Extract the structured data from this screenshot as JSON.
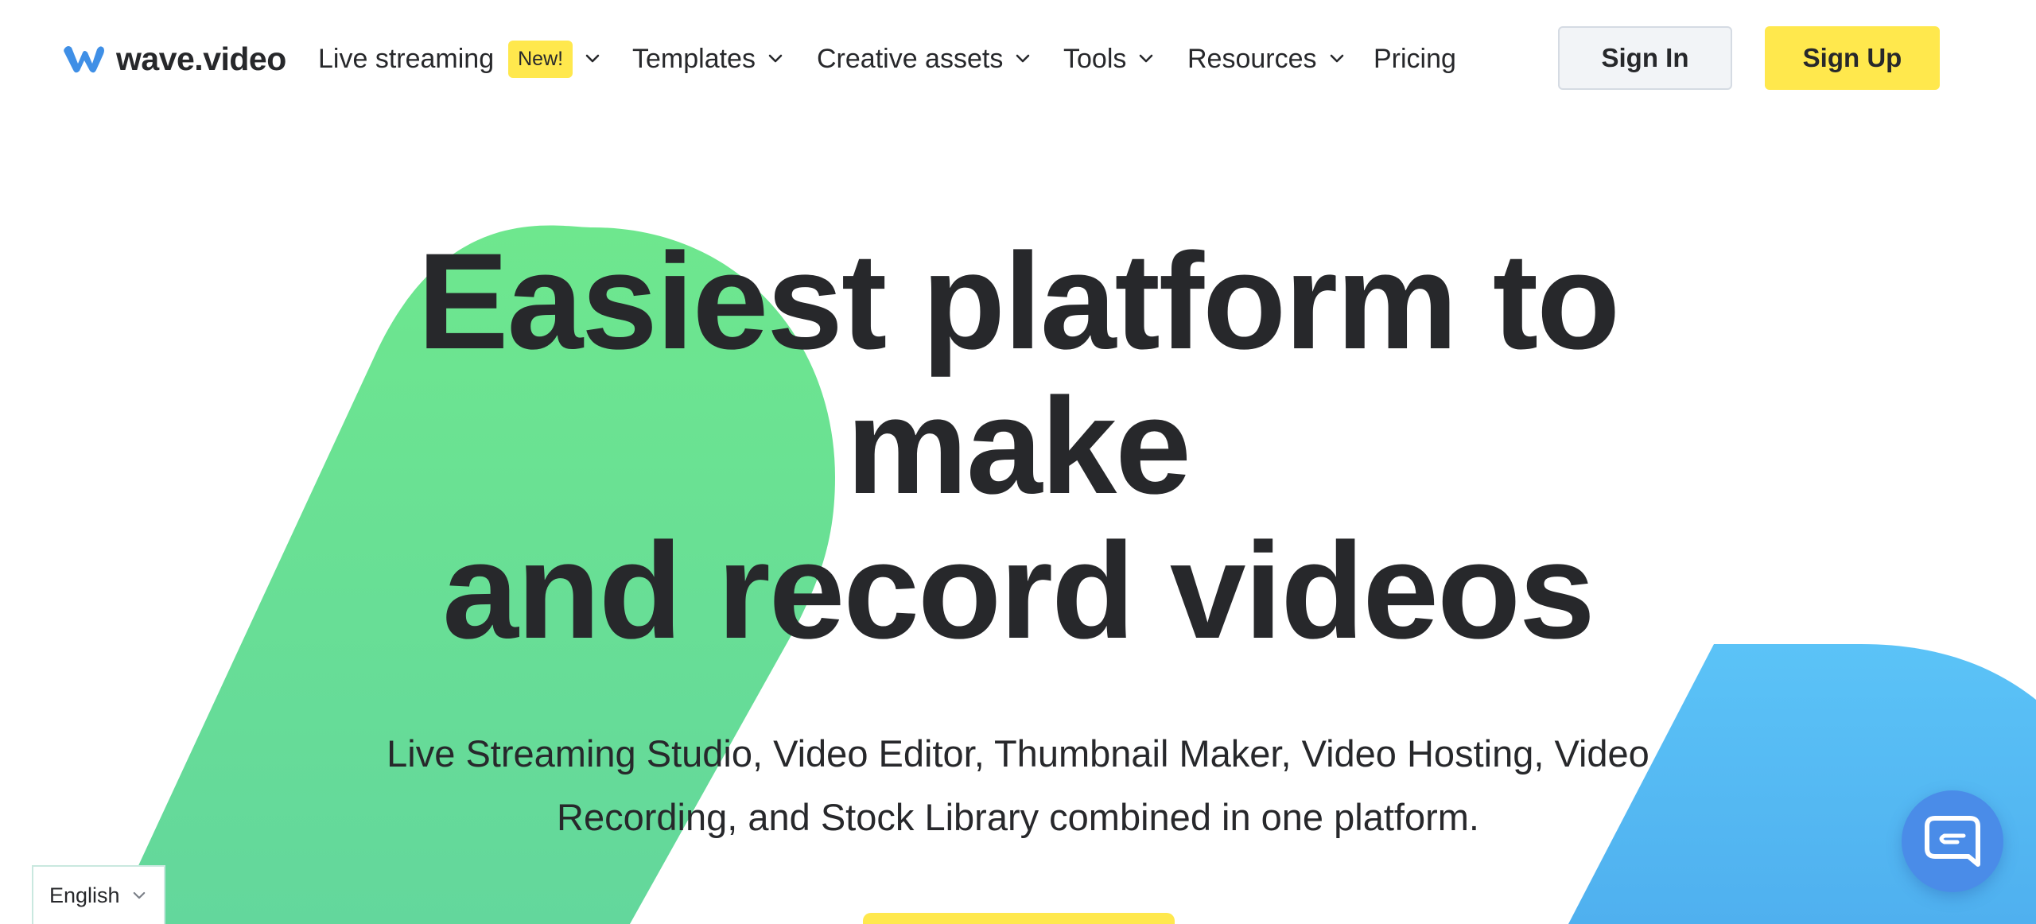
{
  "brand": {
    "name": "wave.video",
    "colors": {
      "text": "#27282b",
      "yellow": "#ffe84d",
      "green": "#6ee78e",
      "blue": "#5bc0f6",
      "logo_blue": "#3f8fe6",
      "chat_blue": "#4a8ce8"
    }
  },
  "nav": {
    "items": [
      {
        "label": "Live streaming",
        "badge": "New!",
        "has_dropdown": true
      },
      {
        "label": "Templates",
        "has_dropdown": true
      },
      {
        "label": "Creative assets",
        "has_dropdown": true
      },
      {
        "label": "Tools",
        "has_dropdown": true
      },
      {
        "label": "Resources",
        "has_dropdown": true
      },
      {
        "label": "Pricing",
        "has_dropdown": false
      }
    ],
    "sign_in_label": "Sign In",
    "sign_up_label": "Sign Up"
  },
  "hero": {
    "title_lines": [
      "Easiest platform to",
      "make",
      "and record videos"
    ],
    "subtitle_lines": [
      "Live Streaming Studio, Video Editor, Thumbnail Maker, Video Hosting, Video",
      "Recording, and Stock Library combined in one platform."
    ]
  },
  "language_selector": {
    "value": "English",
    "icon": "chevron-down-icon"
  },
  "chat": {
    "icon": "chat-bubble-icon"
  }
}
